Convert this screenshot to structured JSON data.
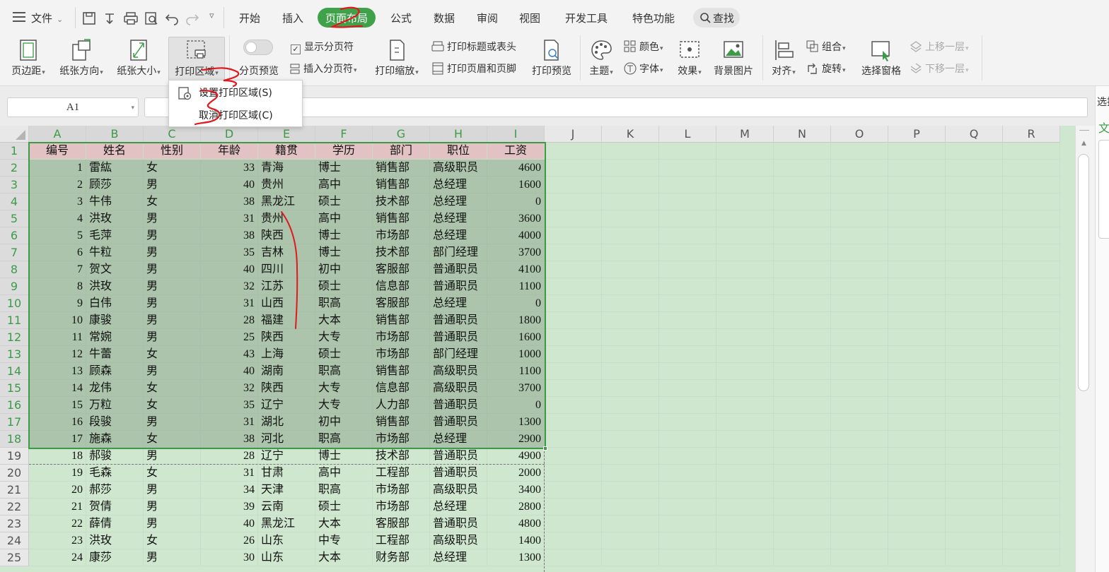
{
  "menubar": {
    "file_label": "文件",
    "tabs": [
      {
        "label": "开始",
        "active": false
      },
      {
        "label": "插入",
        "active": false
      },
      {
        "label": "页面布局",
        "active": true
      },
      {
        "label": "公式",
        "active": false
      },
      {
        "label": "数据",
        "active": false
      },
      {
        "label": "审阅",
        "active": false
      },
      {
        "label": "视图",
        "active": false
      },
      {
        "label": "开发工具",
        "active": false
      },
      {
        "label": "特色功能",
        "active": false
      }
    ],
    "search_label": "查找"
  },
  "ribbon": {
    "margins": "页边距",
    "orientation": "纸张方向",
    "size": "纸张大小",
    "print_area": "打印区域",
    "page_break_preview": "分页预览",
    "show_page_breaks": "显示分页符",
    "insert_page_break": "插入分页符",
    "print_scale": "打印缩放",
    "print_titles": "打印标题或表头",
    "print_header_footer": "打印页眉和页脚",
    "print_preview": "打印预览",
    "theme": "主题",
    "colors": "颜色",
    "fonts": "字体",
    "effects": "效果",
    "background": "背景图片",
    "align": "对齐",
    "group": "组合",
    "rotate": "旋转",
    "selection_pane": "选择窗格",
    "bring_forward": "上移一层",
    "send_backward": "下移一层"
  },
  "dropdown": {
    "set_print_area": "设置打印区域(S)",
    "clear_print_area": "取消打印区域(C)"
  },
  "formula_bar": {
    "name_box": "A1"
  },
  "right_panel": {
    "label_top": "选择",
    "label_mid": "文"
  },
  "sheet": {
    "column_letters": [
      "A",
      "B",
      "C",
      "D",
      "E",
      "F",
      "G",
      "H",
      "I",
      "J",
      "K",
      "L",
      "M",
      "N",
      "O",
      "P",
      "Q",
      "R"
    ],
    "headers": [
      "编号",
      "姓名",
      "性别",
      "年龄",
      "籍贯",
      "学历",
      "部门",
      "职位",
      "工资"
    ],
    "rows": [
      [
        "1",
        "雷紘",
        "女",
        "33",
        "青海",
        "博士",
        "销售部",
        "高级职员",
        "4600"
      ],
      [
        "2",
        "顾莎",
        "男",
        "40",
        "贵州",
        "高中",
        "销售部",
        "总经理",
        "1600"
      ],
      [
        "3",
        "牛伟",
        "女",
        "38",
        "黑龙江",
        "硕士",
        "技术部",
        "总经理",
        "0"
      ],
      [
        "4",
        "洪玫",
        "男",
        "31",
        "贵州",
        "高中",
        "销售部",
        "总经理",
        "3600"
      ],
      [
        "5",
        "毛萍",
        "男",
        "38",
        "陕西",
        "博士",
        "市场部",
        "总经理",
        "4000"
      ],
      [
        "6",
        "牛粒",
        "男",
        "35",
        "吉林",
        "博士",
        "技术部",
        "部门经理",
        "3700"
      ],
      [
        "7",
        "贺文",
        "男",
        "40",
        "四川",
        "初中",
        "客服部",
        "普通职员",
        "4100"
      ],
      [
        "8",
        "洪玫",
        "男",
        "32",
        "江苏",
        "硕士",
        "信息部",
        "普通职员",
        "1100"
      ],
      [
        "9",
        "白伟",
        "男",
        "31",
        "山西",
        "职高",
        "客服部",
        "总经理",
        "0"
      ],
      [
        "10",
        "康骏",
        "男",
        "28",
        "福建",
        "大本",
        "销售部",
        "普通职员",
        "1800"
      ],
      [
        "11",
        "常婉",
        "男",
        "25",
        "陕西",
        "大专",
        "市场部",
        "普通职员",
        "1600"
      ],
      [
        "12",
        "牛蕾",
        "女",
        "43",
        "上海",
        "硕士",
        "市场部",
        "部门经理",
        "1000"
      ],
      [
        "13",
        "顾森",
        "男",
        "40",
        "湖南",
        "职高",
        "销售部",
        "高级职员",
        "1100"
      ],
      [
        "14",
        "龙伟",
        "女",
        "32",
        "陕西",
        "大专",
        "信息部",
        "高级职员",
        "3700"
      ],
      [
        "15",
        "万粒",
        "女",
        "35",
        "辽宁",
        "大专",
        "人力部",
        "普通职员",
        "0"
      ],
      [
        "16",
        "段骏",
        "男",
        "31",
        "湖北",
        "初中",
        "销售部",
        "普通职员",
        "1300"
      ],
      [
        "17",
        "施森",
        "女",
        "38",
        "河北",
        "职高",
        "市场部",
        "总经理",
        "2900"
      ],
      [
        "18",
        "郝骏",
        "男",
        "28",
        "辽宁",
        "博士",
        "技术部",
        "普通职员",
        "4900"
      ],
      [
        "19",
        "毛森",
        "女",
        "31",
        "甘肃",
        "高中",
        "工程部",
        "普通职员",
        "2000"
      ],
      [
        "20",
        "郝莎",
        "男",
        "34",
        "天津",
        "职高",
        "市场部",
        "高级职员",
        "3400"
      ],
      [
        "21",
        "贺倩",
        "男",
        "39",
        "云南",
        "硕士",
        "市场部",
        "总经理",
        "2800"
      ],
      [
        "22",
        "薛倩",
        "男",
        "40",
        "黑龙江",
        "大本",
        "客服部",
        "普通职员",
        "4800"
      ],
      [
        "23",
        "洪玫",
        "女",
        "26",
        "山东",
        "中专",
        "工程部",
        "高级职员",
        "1400"
      ],
      [
        "24",
        "康莎",
        "男",
        "30",
        "山东",
        "大本",
        "财务部",
        "总经理",
        "1300"
      ]
    ]
  }
}
